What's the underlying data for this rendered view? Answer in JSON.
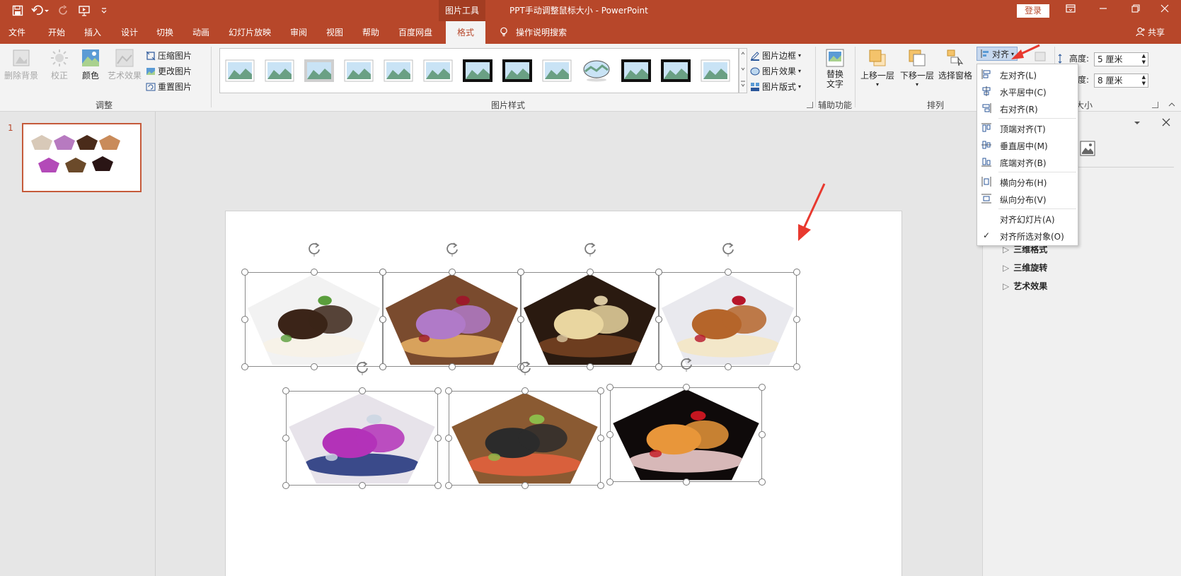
{
  "title_bar": {
    "context_tools": "图片工具",
    "doc_title": "PPT手动调整鼠标大小  -  PowerPoint",
    "login": "登录"
  },
  "tabs": [
    {
      "label": "文件"
    },
    {
      "label": "开始"
    },
    {
      "label": "插入"
    },
    {
      "label": "设计"
    },
    {
      "label": "切换"
    },
    {
      "label": "动画"
    },
    {
      "label": "幻灯片放映"
    },
    {
      "label": "审阅"
    },
    {
      "label": "视图"
    },
    {
      "label": "帮助"
    },
    {
      "label": "百度网盘"
    },
    {
      "label": "格式"
    }
  ],
  "tell_me": "操作说明搜索",
  "share": "共享",
  "ribbon": {
    "adjust": {
      "remove_bg": "删除背景",
      "correct": "校正",
      "color": "颜色",
      "art_effects": "艺术效果",
      "compress": "压缩图片",
      "change_pic": "更改图片",
      "reset_pic": "重置图片",
      "label": "调整"
    },
    "styles": {
      "border": "图片边框",
      "effects": "图片效果",
      "layout": "图片版式",
      "label": "图片样式"
    },
    "accessibility": {
      "alt_text_1": "替换",
      "alt_text_2": "文字",
      "label": "辅助功能"
    },
    "arrange": {
      "bring_forward": "上移一层",
      "send_backward": "下移一层",
      "selection_pane": "选择窗格",
      "align": "对齐",
      "label": "排列"
    },
    "size": {
      "height_label": "高度:",
      "height_value": "5 厘米",
      "width_label": "宽度:",
      "width_value": "8 厘米",
      "label": "大小"
    }
  },
  "slide_panel": {
    "slide_number": "1"
  },
  "align_menu": {
    "items": [
      {
        "label": "左对齐(L)",
        "checked": false
      },
      {
        "label": "水平居中(C)",
        "checked": false
      },
      {
        "label": "右对齐(R)",
        "checked": false
      },
      {
        "label": "顶端对齐(T)",
        "checked": false
      },
      {
        "label": "垂直居中(M)",
        "checked": false
      },
      {
        "label": "底端对齐(B)",
        "checked": false
      },
      {
        "label": "横向分布(H)",
        "checked": false
      },
      {
        "label": "纵向分布(V)",
        "checked": false
      },
      {
        "label": "对齐幻灯片(A)",
        "checked": false
      },
      {
        "label": "对齐所选对象(O)",
        "checked": true
      }
    ]
  },
  "format_pane": {
    "items": [
      {
        "label": "三维格式"
      },
      {
        "label": "三维旋转"
      },
      {
        "label": "艺术效果"
      }
    ]
  },
  "colors": {
    "brand": "#b7472a",
    "arrow": "#e8392f"
  }
}
